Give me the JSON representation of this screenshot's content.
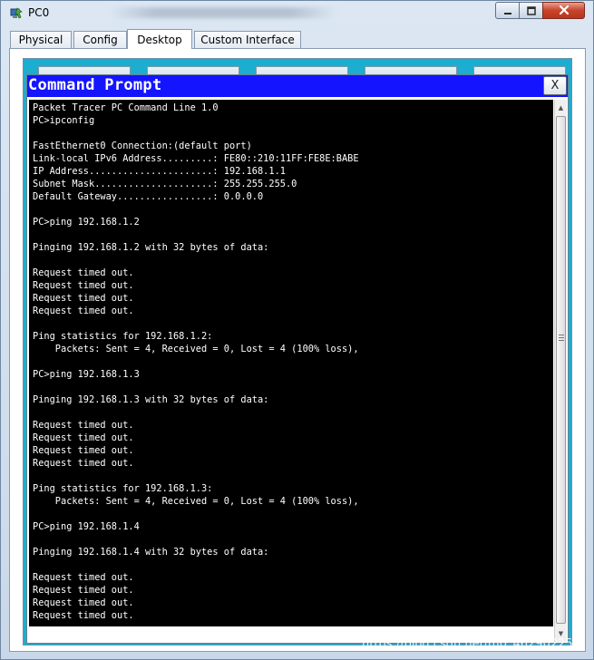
{
  "window": {
    "title": "PC0",
    "controls": {
      "minimize": "minimize",
      "maximize": "maximize",
      "close": "close"
    }
  },
  "tabs": [
    {
      "label": "Physical"
    },
    {
      "label": "Config"
    },
    {
      "label": "Desktop",
      "active": true
    },
    {
      "label": "Custom Interface"
    }
  ],
  "command_prompt": {
    "title": "Command Prompt",
    "close_label": "X",
    "output": "Packet Tracer PC Command Line 1.0\nPC>ipconfig\n\nFastEthernet0 Connection:(default port)\nLink-local IPv6 Address.........: FE80::210:11FF:FE8E:BABE\nIP Address......................: 192.168.1.1\nSubnet Mask.....................: 255.255.255.0\nDefault Gateway.................: 0.0.0.0\n\nPC>ping 192.168.1.2\n\nPinging 192.168.1.2 with 32 bytes of data:\n\nRequest timed out.\nRequest timed out.\nRequest timed out.\nRequest timed out.\n\nPing statistics for 192.168.1.2:\n    Packets: Sent = 4, Received = 0, Lost = 4 (100% loss),\n\nPC>ping 192.168.1.3\n\nPinging 192.168.1.3 with 32 bytes of data:\n\nRequest timed out.\nRequest timed out.\nRequest timed out.\nRequest timed out.\n\nPing statistics for 192.168.1.3:\n    Packets: Sent = 4, Received = 0, Lost = 4 (100% loss),\n\nPC>ping 192.168.1.4\n\nPinging 192.168.1.4 with 32 bytes of data:\n\nRequest timed out.\nRequest timed out.\nRequest timed out.\nRequest timed out."
  },
  "watermark": "https://blog.csdn.net/m0_46290225",
  "colors": {
    "cmd_title_bg": "#1414ff",
    "terminal_bg": "#000000",
    "terminal_fg": "#ffffff",
    "desktop_bg": "#1baed0",
    "close_button": "#c7432a"
  }
}
